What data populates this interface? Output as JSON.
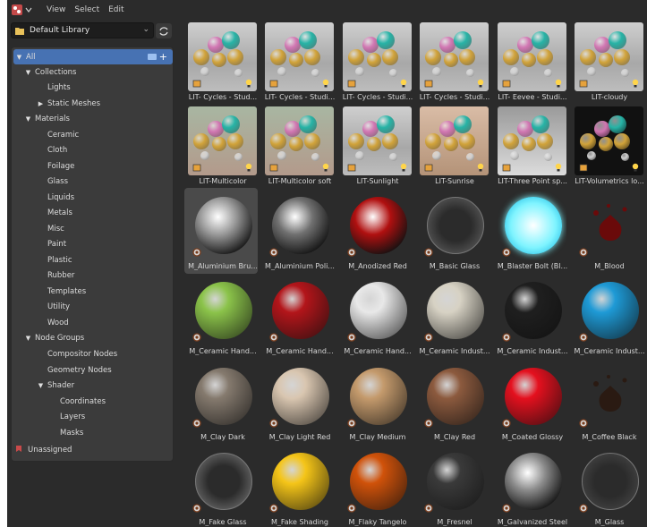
{
  "menu": {
    "items": [
      "View",
      "Select",
      "Edit"
    ]
  },
  "library": {
    "selected": "Default Library"
  },
  "tree": [
    {
      "label": "All",
      "level": 0,
      "caret": "open",
      "selected": true
    },
    {
      "label": "Collections",
      "level": 1,
      "caret": "open"
    },
    {
      "label": "Lights",
      "level": 2,
      "caret": "none"
    },
    {
      "label": "Static Meshes",
      "level": 2,
      "caret": "closed"
    },
    {
      "label": "Materials",
      "level": 1,
      "caret": "open"
    },
    {
      "label": "Ceramic",
      "level": 2,
      "caret": "none"
    },
    {
      "label": "Cloth",
      "level": 2,
      "caret": "none"
    },
    {
      "label": "Foilage",
      "level": 2,
      "caret": "none"
    },
    {
      "label": "Glass",
      "level": 2,
      "caret": "none"
    },
    {
      "label": "Liquids",
      "level": 2,
      "caret": "none"
    },
    {
      "label": "Metals",
      "level": 2,
      "caret": "none"
    },
    {
      "label": "Misc",
      "level": 2,
      "caret": "none"
    },
    {
      "label": "Paint",
      "level": 2,
      "caret": "none"
    },
    {
      "label": "Plastic",
      "level": 2,
      "caret": "none"
    },
    {
      "label": "Rubber",
      "level": 2,
      "caret": "none"
    },
    {
      "label": "Templates",
      "level": 2,
      "caret": "none"
    },
    {
      "label": "Utility",
      "level": 2,
      "caret": "none"
    },
    {
      "label": "Wood",
      "level": 2,
      "caret": "none"
    },
    {
      "label": "Node Groups",
      "level": 1,
      "caret": "open"
    },
    {
      "label": "Compositor Nodes",
      "level": 2,
      "caret": "none"
    },
    {
      "label": "Geometry Nodes",
      "level": 2,
      "caret": "none"
    },
    {
      "label": "Shader",
      "level": 2,
      "caret": "open"
    },
    {
      "label": "Coordinates",
      "level": 3,
      "caret": "none"
    },
    {
      "label": "Layers",
      "level": 3,
      "caret": "none"
    },
    {
      "label": "Masks",
      "level": 3,
      "caret": "none"
    },
    {
      "label": "Unassigned",
      "level": -1,
      "caret": "none",
      "icon": "unassigned-icon"
    }
  ],
  "assets": [
    {
      "label": "LIT- Cycles - Stud...",
      "kind": "scene",
      "style": "studio"
    },
    {
      "label": "LIT- Cycles - Studi...",
      "kind": "scene",
      "style": "studio"
    },
    {
      "label": "LIT- Cycles - Studi...",
      "kind": "scene",
      "style": "studio"
    },
    {
      "label": "LIT- Cycles - Studi...",
      "kind": "scene",
      "style": "studio"
    },
    {
      "label": "LIT- Eevee - Studi...",
      "kind": "scene",
      "style": "studio"
    },
    {
      "label": "LIT-cloudy",
      "kind": "scene",
      "style": "studio"
    },
    {
      "label": "LIT-Multicolor",
      "kind": "scene",
      "style": "color"
    },
    {
      "label": "LIT-Multicolor soft",
      "kind": "scene",
      "style": "color"
    },
    {
      "label": "LIT-Sunlight",
      "kind": "scene",
      "style": "studio"
    },
    {
      "label": "LIT-Sunrise",
      "kind": "scene",
      "style": "sunset"
    },
    {
      "label": "LIT-Three Point sp...",
      "kind": "scene",
      "style": "three"
    },
    {
      "label": "LIT-Volumetrics lo...",
      "kind": "scene",
      "style": "dark"
    },
    {
      "label": "M_Aluminium Bru...",
      "kind": "metal",
      "color": "#9a9a9a",
      "active": true
    },
    {
      "label": "M_Aluminium Poli...",
      "kind": "metal",
      "color": "#707070"
    },
    {
      "label": "M_Anodized Red",
      "kind": "metal",
      "color": "#b01010"
    },
    {
      "label": "M_Basic Glass",
      "kind": "glass",
      "color": "#4a4a4a"
    },
    {
      "label": "M_Blaster Bolt (Bl...",
      "kind": "sphere",
      "color": "#7ff4ff",
      "glow": true
    },
    {
      "label": "M_Blood",
      "kind": "splash",
      "color": "#6a0a0a"
    },
    {
      "label": "M_Ceramic Hand...",
      "kind": "sphere",
      "color": "#8bc34a"
    },
    {
      "label": "M_Ceramic Hand...",
      "kind": "sphere",
      "color": "#b3151a"
    },
    {
      "label": "M_Ceramic Hand...",
      "kind": "sphere",
      "color": "#e8e8e8"
    },
    {
      "label": "M_Ceramic Indust...",
      "kind": "sphere",
      "color": "#d7d2c4"
    },
    {
      "label": "M_Ceramic Indust...",
      "kind": "sphere",
      "color": "#1f1f1f"
    },
    {
      "label": "M_Ceramic Indust...",
      "kind": "sphere",
      "color": "#1e9ad6"
    },
    {
      "label": "M_Clay Dark",
      "kind": "sphere",
      "color": "#857a6e"
    },
    {
      "label": "M_Clay Light Red",
      "kind": "sphere",
      "color": "#d9c6b0"
    },
    {
      "label": "M_Clay Medium",
      "kind": "sphere",
      "color": "#c49a6c"
    },
    {
      "label": "M_Clay Red",
      "kind": "sphere",
      "color": "#8c5a3e"
    },
    {
      "label": "M_Coated Glossy",
      "kind": "sphere",
      "color": "#e4101e"
    },
    {
      "label": "M_Coffee Black",
      "kind": "splash",
      "color": "#2a1a12"
    },
    {
      "label": "M_Fake Glass",
      "kind": "glass",
      "color": "#555555"
    },
    {
      "label": "M_Fake Shading",
      "kind": "sphere",
      "color": "#f5c518"
    },
    {
      "label": "M_Flaky Tangelo",
      "kind": "sphere",
      "color": "#d0520a"
    },
    {
      "label": "M_Fresnel",
      "kind": "sphere",
      "color": "#3a3a3a"
    },
    {
      "label": "M_Galvanized Steel",
      "kind": "metal",
      "color": "#8a8a8a"
    },
    {
      "label": "M_Glass",
      "kind": "glass",
      "color": "#3c3c3c"
    }
  ]
}
